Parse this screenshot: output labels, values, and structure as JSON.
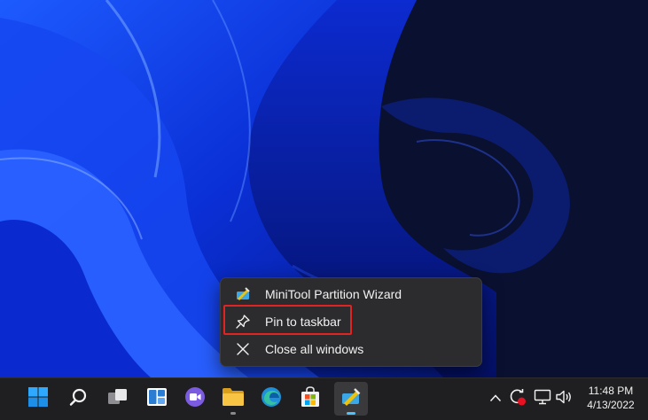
{
  "context_menu": {
    "items": [
      {
        "label": "MiniTool Partition Wizard",
        "icon": "minitool-app-icon"
      },
      {
        "label": "Pin to taskbar",
        "icon": "pin-icon"
      },
      {
        "label": "Close all windows",
        "icon": "close-icon"
      }
    ]
  },
  "taskbar": {
    "apps": [
      {
        "name": "start-icon"
      },
      {
        "name": "search-icon"
      },
      {
        "name": "task-view-icon"
      },
      {
        "name": "widgets-icon"
      },
      {
        "name": "chat-icon"
      },
      {
        "name": "file-explorer-icon"
      },
      {
        "name": "edge-icon"
      },
      {
        "name": "store-icon"
      },
      {
        "name": "minitool-app-icon",
        "active": true
      }
    ],
    "tray": [
      "chevron-up-icon",
      "sync-error-icon",
      "network-icon",
      "volume-icon"
    ]
  },
  "clock": {
    "time": "11:48 PM",
    "date": "4/13/2022"
  },
  "colors": {
    "highlight": "#e02424",
    "menu_bg": "#2c2c2e",
    "taskbar_bg": "#1f1f21",
    "accent": "#4cc2ff"
  }
}
